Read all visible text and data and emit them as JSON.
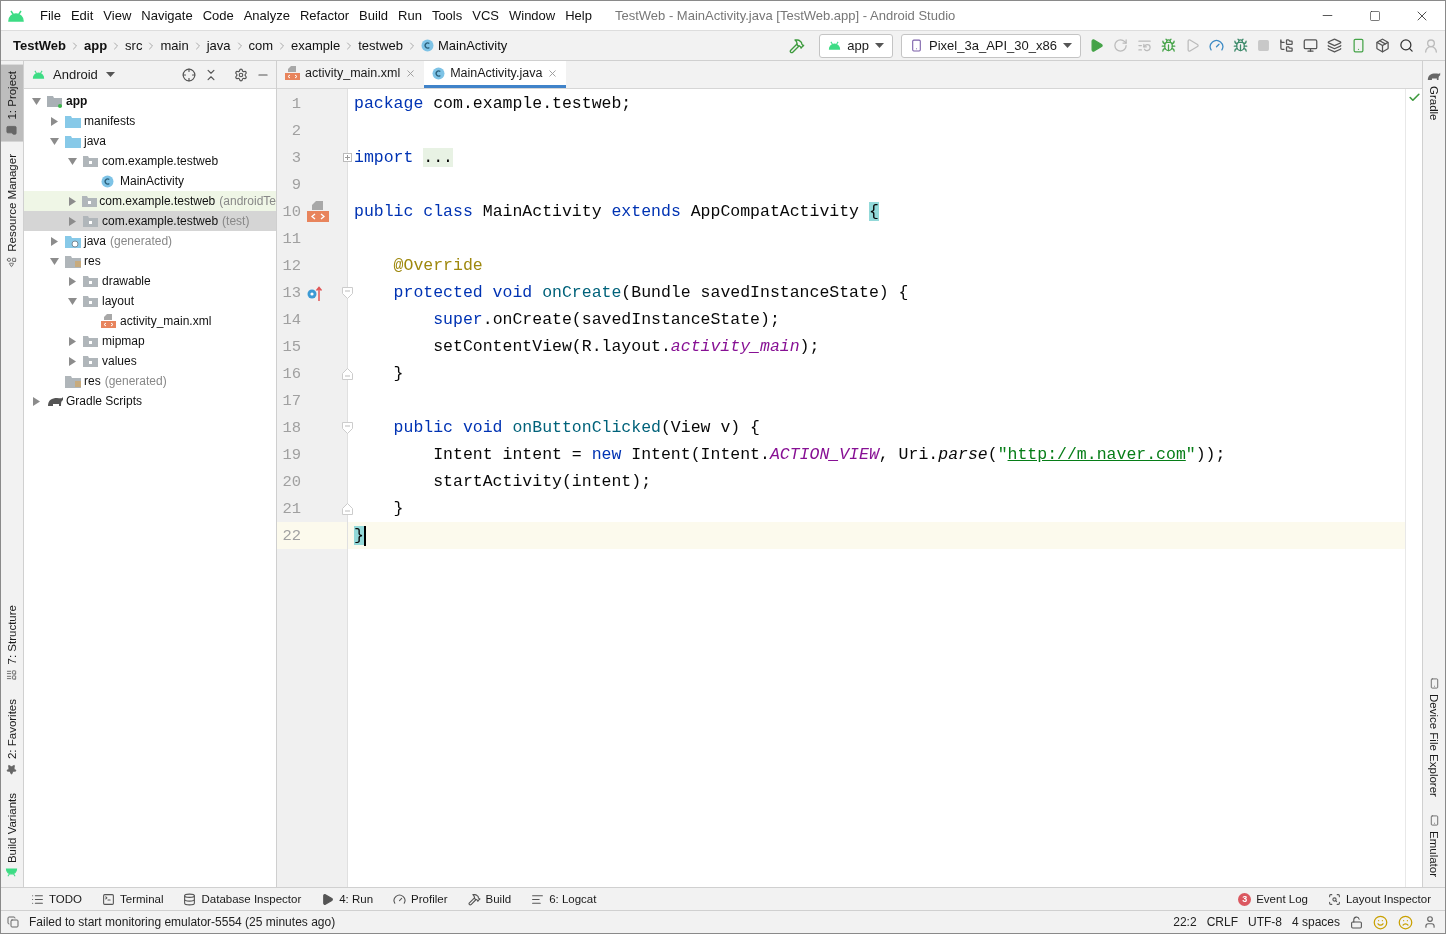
{
  "window": {
    "title": "TestWeb - MainActivity.java [TestWeb.app] - Android Studio"
  },
  "menu": [
    "File",
    "Edit",
    "View",
    "Navigate",
    "Code",
    "Analyze",
    "Refactor",
    "Build",
    "Run",
    "Tools",
    "VCS",
    "Window",
    "Help"
  ],
  "breadcrumbs": [
    {
      "label": "TestWeb",
      "kind": "project"
    },
    {
      "label": "app",
      "kind": "module"
    },
    {
      "label": "src",
      "kind": "dir"
    },
    {
      "label": "main",
      "kind": "dir"
    },
    {
      "label": "java",
      "kind": "dir"
    },
    {
      "label": "com",
      "kind": "dir"
    },
    {
      "label": "example",
      "kind": "dir"
    },
    {
      "label": "testweb",
      "kind": "dir"
    },
    {
      "label": "MainActivity",
      "kind": "class"
    }
  ],
  "toolbar": {
    "run_config": "app",
    "device": "Pixel_3a_API_30_x86"
  },
  "left_stripe": {
    "top": [
      {
        "label": "1: Project",
        "selected": true
      },
      {
        "label": "Resource Manager",
        "selected": false
      }
    ],
    "bottom": [
      {
        "label": "7: Structure",
        "selected": false
      },
      {
        "label": "2: Favorites",
        "selected": false
      },
      {
        "label": "Build Variants",
        "selected": false
      }
    ]
  },
  "right_stripe": {
    "top": [
      {
        "label": "Gradle",
        "selected": false
      }
    ],
    "bottom": [
      {
        "label": "Device File Explorer",
        "selected": false
      },
      {
        "label": "Emulator",
        "selected": false
      }
    ]
  },
  "project_panel": {
    "view": "Android",
    "tree": [
      {
        "label": "app",
        "kind": "module",
        "expanded": true,
        "selected": false,
        "tinted": false,
        "children": [
          {
            "label": "manifests",
            "kind": "folder",
            "expanded": false,
            "selected": false,
            "tinted": false
          },
          {
            "label": "java",
            "kind": "folder",
            "expanded": true,
            "selected": false,
            "tinted": false,
            "children": [
              {
                "label": "com.example.testweb",
                "kind": "package",
                "expanded": true,
                "selected": false,
                "tinted": false,
                "children": [
                  {
                    "label": "MainActivity",
                    "kind": "class",
                    "selected": false,
                    "tinted": false
                  }
                ]
              },
              {
                "label": "com.example.testweb",
                "suffix": "(androidTe",
                "kind": "package",
                "expanded": false,
                "selected": false,
                "tinted": true
              },
              {
                "label": "com.example.testweb",
                "suffix": "(test)",
                "kind": "package",
                "expanded": false,
                "selected": true,
                "tinted": false
              }
            ]
          },
          {
            "label": "java",
            "suffix": "(generated)",
            "kind": "generated",
            "expanded": false,
            "selected": false,
            "tinted": false
          },
          {
            "label": "res",
            "kind": "res",
            "expanded": true,
            "selected": false,
            "tinted": false,
            "children": [
              {
                "label": "drawable",
                "kind": "package",
                "expanded": false,
                "selected": false,
                "tinted": false
              },
              {
                "label": "layout",
                "kind": "package",
                "expanded": true,
                "selected": false,
                "tinted": false,
                "children": [
                  {
                    "label": "activity_main.xml",
                    "kind": "xml",
                    "selected": false,
                    "tinted": false
                  }
                ]
              },
              {
                "label": "mipmap",
                "kind": "package",
                "expanded": false,
                "selected": false,
                "tinted": false
              },
              {
                "label": "values",
                "kind": "package",
                "expanded": false,
                "selected": false,
                "tinted": false
              }
            ]
          },
          {
            "label": "res",
            "suffix": "(generated)",
            "kind": "res",
            "selected": false,
            "tinted": false
          }
        ]
      },
      {
        "label": "Gradle Scripts",
        "kind": "gradle",
        "expanded": false,
        "selected": false,
        "tinted": false
      }
    ]
  },
  "tabs": [
    {
      "label": "activity_main.xml",
      "kind": "xml",
      "selected": false
    },
    {
      "label": "MainActivity.java",
      "kind": "java",
      "selected": true
    }
  ],
  "code": [
    {
      "number": "1",
      "current": false,
      "tokens": [
        {
          "text": "package ",
          "kind": "kw"
        },
        {
          "text": "com.example.testweb;",
          "kind": "plain"
        }
      ]
    },
    {
      "number": "2",
      "current": false
    },
    {
      "number": "3",
      "current": false,
      "fold_marker": {
        "kind": "collapsed"
      },
      "tokens": [
        {
          "text": "import ",
          "kind": "kw"
        },
        {
          "text": "...",
          "kind": "folded"
        }
      ]
    },
    {
      "number": "9",
      "current": false
    },
    {
      "number": "10",
      "current": false,
      "gutter_icon": {
        "kind": "layout"
      },
      "tokens": [
        {
          "text": "public class ",
          "kind": "kw"
        },
        {
          "text": "MainActivity ",
          "kind": "plain"
        },
        {
          "text": "extends ",
          "kind": "kw"
        },
        {
          "text": "AppCompatActivity ",
          "kind": "plain"
        },
        {
          "text": "{",
          "kind": "brace"
        }
      ]
    },
    {
      "number": "11",
      "current": false
    },
    {
      "number": "12",
      "current": false,
      "tokens": [
        {
          "text": "    @Override",
          "kind": "anno"
        }
      ]
    },
    {
      "number": "13",
      "current": false,
      "gutter_icon": {
        "kind": "override"
      },
      "fold_marker": {
        "kind": "open"
      },
      "tokens": [
        {
          "text": "    protected void ",
          "kind": "kw"
        },
        {
          "text": "onCreate",
          "kind": "decl"
        },
        {
          "text": "(Bundle savedInstanceState) {",
          "kind": "plain"
        }
      ]
    },
    {
      "number": "14",
      "current": false,
      "tokens": [
        {
          "text": "        super",
          "kind": "kw"
        },
        {
          "text": ".onCreate(savedInstanceState);",
          "kind": "plain"
        }
      ]
    },
    {
      "number": "15",
      "current": false,
      "tokens": [
        {
          "text": "        setContentView(R.layout.",
          "kind": "plain"
        },
        {
          "text": "activity_main",
          "kind": "field"
        },
        {
          "text": ");",
          "kind": "plain"
        }
      ]
    },
    {
      "number": "16",
      "current": false,
      "fold_marker": {
        "kind": "close"
      },
      "tokens": [
        {
          "text": "    }",
          "kind": "plain"
        }
      ]
    },
    {
      "number": "17",
      "current": false
    },
    {
      "number": "18",
      "current": false,
      "fold_marker": {
        "kind": "open"
      },
      "tokens": [
        {
          "text": "    public void ",
          "kind": "kw"
        },
        {
          "text": "onButtonClicked",
          "kind": "decl"
        },
        {
          "text": "(View v) {",
          "kind": "plain"
        }
      ]
    },
    {
      "number": "19",
      "current": false,
      "tokens": [
        {
          "text": "        Intent intent = ",
          "kind": "plain"
        },
        {
          "text": "new",
          "kind": "kw"
        },
        {
          "text": " Intent(Intent.",
          "kind": "plain"
        },
        {
          "text": "ACTION_VIEW",
          "kind": "field"
        },
        {
          "text": ", Uri.",
          "kind": "plain"
        },
        {
          "text": "parse",
          "kind": "italic"
        },
        {
          "text": "(",
          "kind": "plain"
        },
        {
          "text": "\"",
          "kind": "str"
        },
        {
          "text": "http://m.naver.com",
          "kind": "link"
        },
        {
          "text": "\"",
          "kind": "str"
        },
        {
          "text": "));",
          "kind": "plain"
        }
      ]
    },
    {
      "number": "20",
      "current": false,
      "tokens": [
        {
          "text": "        startActivity(intent);",
          "kind": "plain"
        }
      ]
    },
    {
      "number": "21",
      "current": false,
      "fold_marker": {
        "kind": "close"
      },
      "tokens": [
        {
          "text": "    }",
          "kind": "plain"
        }
      ]
    },
    {
      "number": "22",
      "current": true,
      "tokens": [
        {
          "text": "}",
          "kind": "brace"
        }
      ]
    }
  ],
  "tool_windows": {
    "left": [
      {
        "label": "TODO",
        "kind": "todo"
      },
      {
        "label": "Terminal",
        "kind": "terminal"
      },
      {
        "label": "Database Inspector",
        "kind": "database"
      },
      {
        "label": "4: Run",
        "kind": "run"
      },
      {
        "label": "Profiler",
        "kind": "profiler"
      },
      {
        "label": "Build",
        "kind": "build"
      },
      {
        "label": "6: Logcat",
        "kind": "logcat"
      }
    ],
    "right": [
      {
        "label": "Event Log",
        "kind": "event",
        "badge": "3"
      },
      {
        "label": "Layout Inspector",
        "kind": "inspector"
      }
    ]
  },
  "status_bar": {
    "message": "Failed to start monitoring emulator-5554 (25 minutes ago)",
    "items": [
      "22:2",
      "CRLF",
      "UTF-8",
      "4 spaces"
    ]
  }
}
